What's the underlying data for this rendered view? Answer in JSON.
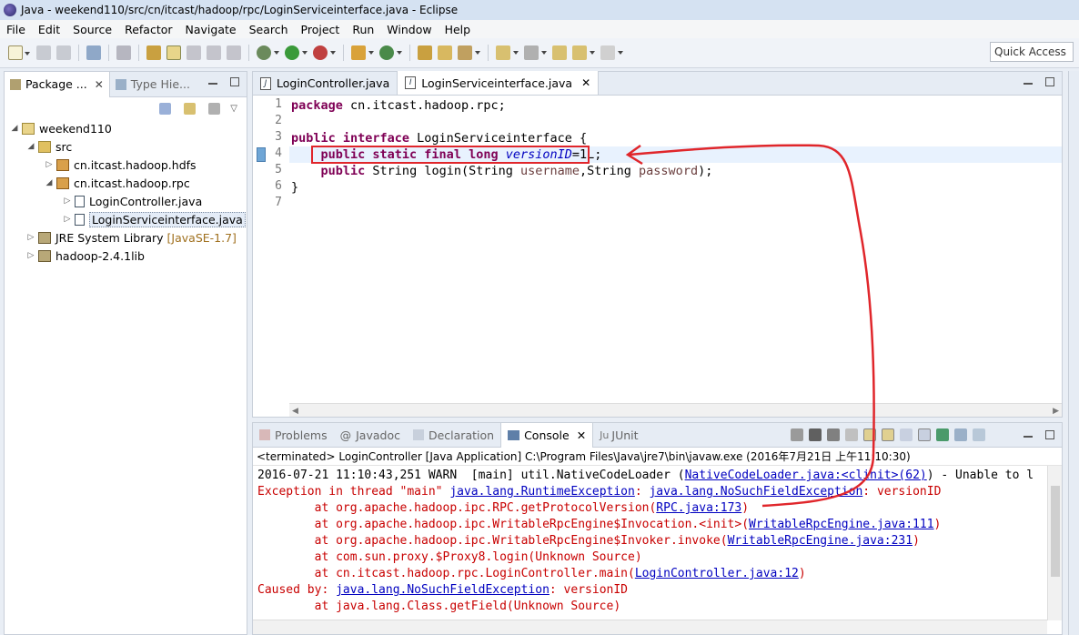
{
  "window": {
    "title": "Java - weekend110/src/cn/itcast/hadoop/rpc/LoginServiceinterface.java - Eclipse"
  },
  "menu": [
    "File",
    "Edit",
    "Source",
    "Refactor",
    "Navigate",
    "Search",
    "Project",
    "Run",
    "Window",
    "Help"
  ],
  "quick_access": "Quick Access",
  "explorer": {
    "tabs": [
      {
        "label": "Package ...",
        "close": "✕"
      },
      {
        "label": "Type Hie..."
      }
    ],
    "tree": [
      {
        "label": "weekend110",
        "indent": 0,
        "twisty": "◢",
        "icon": "project-icon"
      },
      {
        "label": "src",
        "indent": 1,
        "twisty": "◢",
        "icon": "source-folder-icon"
      },
      {
        "label": "cn.itcast.hadoop.hdfs",
        "indent": 2,
        "twisty": "▷",
        "icon": "package-icon"
      },
      {
        "label": "cn.itcast.hadoop.rpc",
        "indent": 2,
        "twisty": "◢",
        "icon": "package-icon"
      },
      {
        "label": "LoginController.java",
        "indent": 3,
        "twisty": "▷",
        "icon": "java-file-icon"
      },
      {
        "label": "LoginServiceinterface.java",
        "indent": 3,
        "twisty": "▷",
        "icon": "java-interface-icon",
        "selected": true
      },
      {
        "label": "JRE System Library",
        "deco": "[JavaSE-1.7]",
        "indent": 0,
        "twisty": "▷",
        "icon": "library-icon"
      },
      {
        "label": "hadoop-2.4.1lib",
        "indent": 0,
        "twisty": "▷",
        "icon": "library-icon"
      }
    ]
  },
  "editor": {
    "tabs": [
      {
        "label": "LoginController.java",
        "active": false
      },
      {
        "label": "LoginServiceinterface.java",
        "active": true,
        "close": "✕"
      }
    ],
    "line_numbers": [
      "1",
      "2",
      "3",
      "4",
      "5",
      "6",
      "7"
    ],
    "code": {
      "l1_kw": "package",
      "l1_rest": " cn.itcast.hadoop.rpc;",
      "l3_kw": "public interface",
      "l3_rest": " LoginServiceinterface {",
      "l4_kw": "public static final long",
      "l4_field": "versionID",
      "l4_rest": "=1L;",
      "l5_kw": "public",
      "l5_a": " String login(String ",
      "l5_p1": "username",
      "l5_b": ",String ",
      "l5_p2": "password",
      "l5_c": ");",
      "l6": "}"
    }
  },
  "console": {
    "tabs": [
      {
        "label": "Problems"
      },
      {
        "label": "Javadoc"
      },
      {
        "label": "Declaration"
      },
      {
        "label": "Console",
        "active": true,
        "close": "✕"
      },
      {
        "label": "JUnit"
      }
    ],
    "status": "<terminated> LoginController [Java Application] C:\\Program Files\\Java\\jre7\\bin\\javaw.exe (2016年7月21日 上午11:10:30)",
    "lines": {
      "warn_a": "2016-07-21 11:10:43,251 WARN  [main] util.NativeCodeLoader (",
      "warn_link": "NativeCodeLoader.java:<clinit>(62)",
      "warn_b": ") - Unable to l",
      "exc_a": "Exception in thread \"main\" ",
      "exc_link1": "java.lang.RuntimeException",
      "exc_b": ": ",
      "exc_link2": "java.lang.NoSuchFieldException",
      "exc_c": ": versionID",
      "at1_a": "        at org.apache.hadoop.ipc.RPC.getProtocolVersion(",
      "at1_link": "RPC.java:173",
      "at1_b": ")",
      "at2_a": "        at org.apache.hadoop.ipc.WritableRpcEngine$Invocation.<init>(",
      "at2_link": "WritableRpcEngine.java:111",
      "at2_b": ")",
      "at3_a": "        at org.apache.hadoop.ipc.WritableRpcEngine$Invoker.invoke(",
      "at3_link": "WritableRpcEngine.java:231",
      "at3_b": ")",
      "at4": "        at com.sun.proxy.$Proxy8.login(Unknown Source)",
      "at5_a": "        at cn.itcast.hadoop.rpc.LoginController.main(",
      "at5_link": "LoginController.java:12",
      "at5_b": ")",
      "cause_a": "Caused by: ",
      "cause_link": "java.lang.NoSuchFieldException",
      "cause_b": ": versionID",
      "at6": "        at java.lang.Class.getField(Unknown Source)"
    }
  },
  "colors": {
    "annotation_red": "#e0262b",
    "keyword": "#7f0055",
    "field": "#0000c0",
    "error": "#c80000"
  }
}
